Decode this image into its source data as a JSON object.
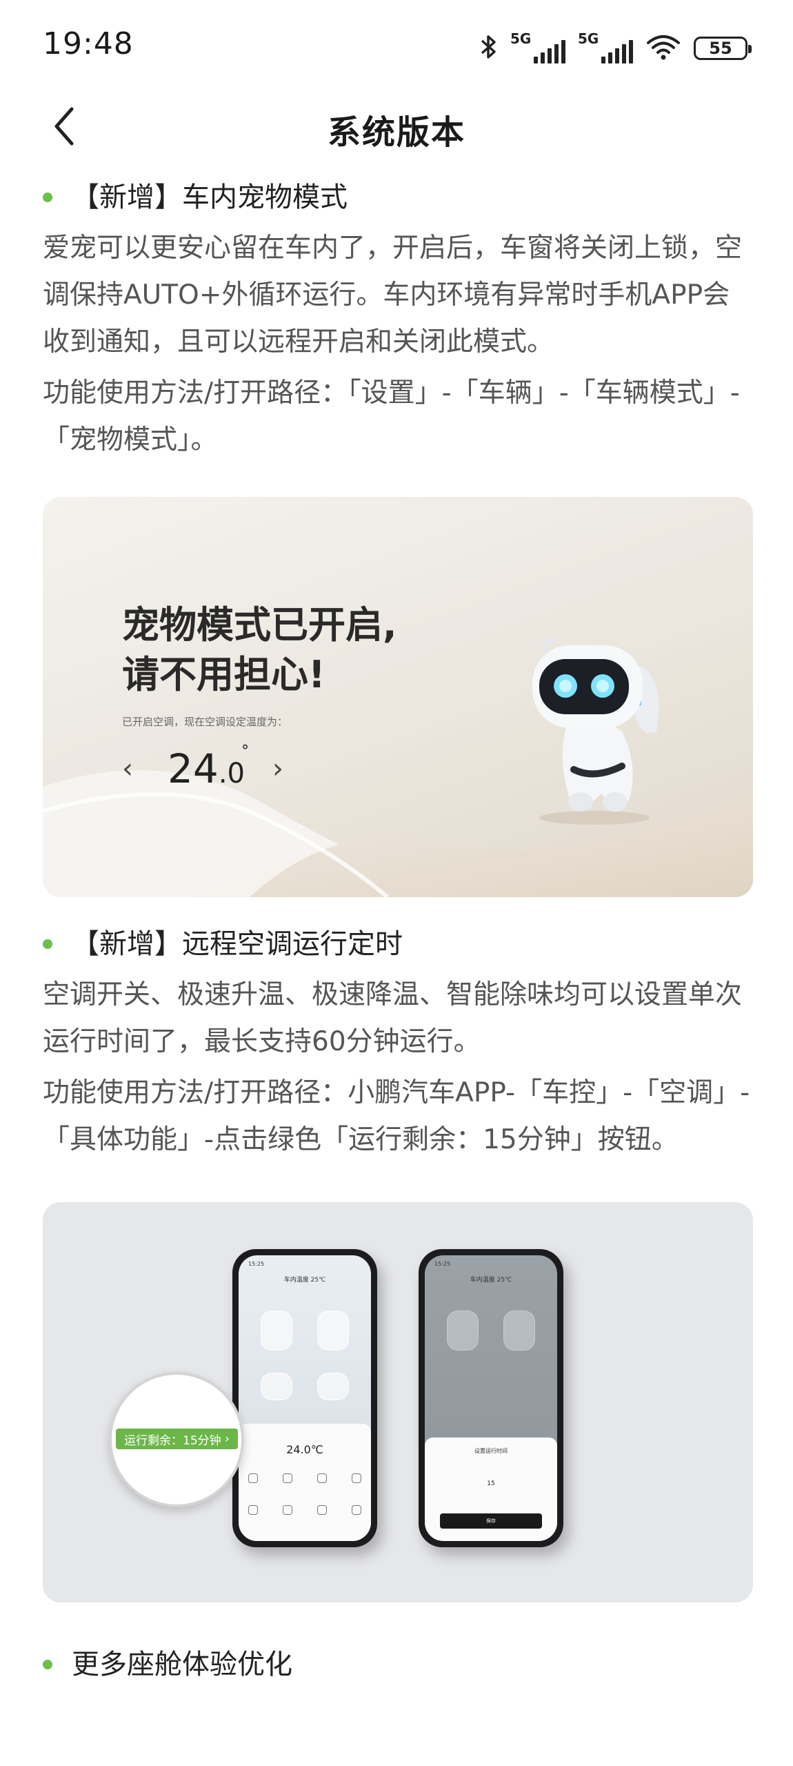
{
  "status_bar": {
    "time": "19:48",
    "network1": "5G",
    "network2": "5G",
    "battery": "55",
    "icons": [
      "bluetooth-icon",
      "signal-icon",
      "signal-icon",
      "wifi-icon",
      "battery-icon"
    ]
  },
  "header": {
    "title": "系统版本",
    "back_icon": "chevron-left-icon"
  },
  "features": [
    {
      "title": "【新增】车内宠物模式",
      "description": "爱宠可以更安心留在车内了，开启后，车窗将关闭上锁，空调保持AUTO+外循环运行。车内环境有异常时手机APP会收到通知，且可以远程开启和关闭此模式。",
      "path": "功能使用方法/打开路径：「设置」-「车辆」-「车辆模式」-「宠物模式」。"
    },
    {
      "title": "【新增】远程空调运行定时",
      "description": "空调开关、极速升温、极速降温、智能除味均可以设置单次运行时间了，最长支持60分钟运行。",
      "path": "功能使用方法/打开路径：小鹏汽车APP-「车控」-「空调」-「具体功能」-点击绿色「运行剩余：15分钟」按钮。"
    },
    {
      "title": "更多座舱体验优化"
    }
  ],
  "pet_card": {
    "headline_line1": "宠物模式已开启,",
    "headline_line2": "请不用担心!",
    "subtitle": "已开启空调，现在空调设定温度为：",
    "temp_int": "24",
    "temp_dec": ".0",
    "temp_unit": "°"
  },
  "phones_card": {
    "phone1_status": "15:25",
    "phone1_title": "车内温度 25℃",
    "phone1_temp": "24.0℃",
    "phone2_status": "15:25",
    "phone2_title": "车内温度 25℃",
    "dialog_title": "设置运行时间",
    "picker_value": "15",
    "confirm_button": "保存",
    "pill_label": "运行剩余：15分钟"
  },
  "colors": {
    "accent_green": "#6cc04a",
    "text_primary": "#222222",
    "text_secondary": "#555555"
  }
}
